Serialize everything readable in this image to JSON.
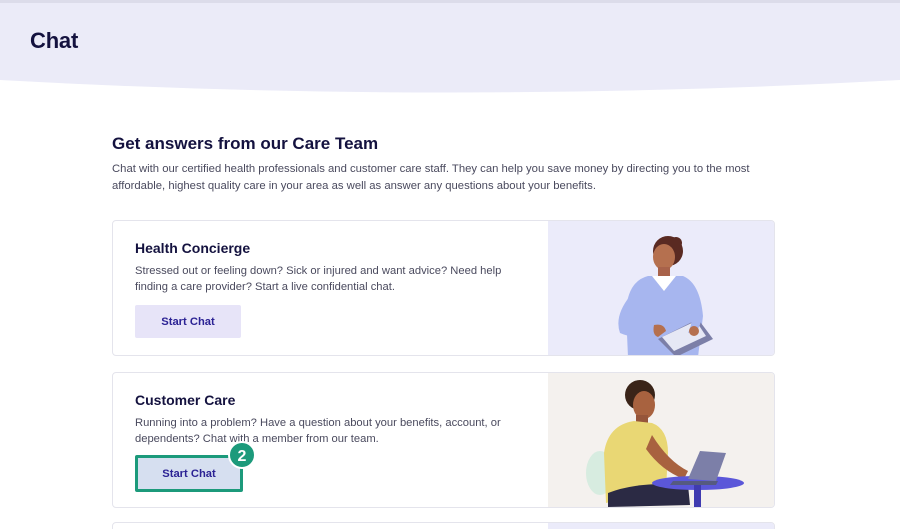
{
  "header": {
    "title": "Chat"
  },
  "intro": {
    "title": "Get answers from our Care Team",
    "description": "Chat with our certified health professionals and customer care staff. They can help you save money by directing you to the most affordable, highest quality care in your area as well as answer any questions about your benefits."
  },
  "cards": [
    {
      "title": "Health Concierge",
      "description": "Stressed out or feeling down? Sick or injured and want advice? Need help finding a care provider? Start a live confidential chat.",
      "button_label": "Start Chat"
    },
    {
      "title": "Customer Care",
      "description": "Running into a problem? Have a question about your benefits, account, or dependents? Chat with a member from our team.",
      "button_label": "Start Chat"
    }
  ],
  "step_badge": "2",
  "colors": {
    "header_band": "#ebebf8",
    "primary_text": "#14123f",
    "button_bg": "#e7e4f8",
    "button_text": "#2b2294",
    "highlight": "#1c9a7b"
  }
}
